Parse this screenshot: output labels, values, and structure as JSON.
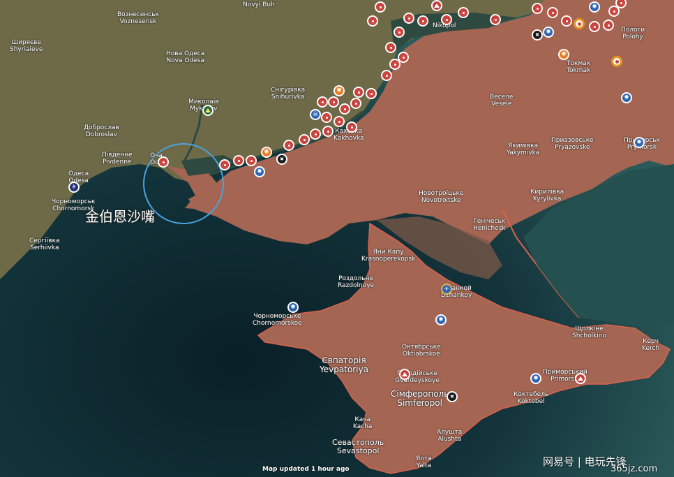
{
  "map": {
    "colors": {
      "sea_deep": "#0e2a33",
      "sea_shallow": "#2b5a5a",
      "ukraine_land": "#6e6a48",
      "occupied_land": "#a46552",
      "occupied_border": "#d9634f",
      "river": "#2e4a40",
      "circle": "#4aa3e0"
    },
    "highlight_label": "金伯恩沙嘴",
    "status_text": "Map updated 1 hour ago",
    "watermark": {
      "line1": "网易号 | 电玩先锋",
      "line2": "365jz.com"
    },
    "places": [
      {
        "key": "voznesensk",
        "name": "Вознесенськ",
        "latin": "Voznesensk"
      },
      {
        "key": "novyi_buh",
        "name": "Novyi Buh",
        "latin": ""
      },
      {
        "key": "shyriaieve",
        "name": "Ширяєве",
        "latin": "Shyriaieve"
      },
      {
        "key": "nova_odesa",
        "name": "Нова Одеса",
        "latin": "Nova Odesa"
      },
      {
        "key": "mykolaiv",
        "name": "Миколаїв",
        "latin": "Mykolaiv"
      },
      {
        "key": "snihurivka",
        "name": "Снігурівка",
        "latin": "Snihurivka"
      },
      {
        "key": "dobroslav",
        "name": "Доброслав",
        "latin": "Dobroslav"
      },
      {
        "key": "pivdenne",
        "name": "Південне",
        "latin": "Pivdenne"
      },
      {
        "key": "ochakiv",
        "name": "Оча",
        "latin": "Och"
      },
      {
        "key": "odesa",
        "name": "Одеса",
        "latin": "Odesa"
      },
      {
        "key": "chornomorsk",
        "name": "Чорноморськ",
        "latin": "Chornomorsk"
      },
      {
        "key": "serhiivka",
        "name": "Сергіївка",
        "latin": "Serhiivka"
      },
      {
        "key": "nikopol",
        "name": "Nikopol",
        "latin": ""
      },
      {
        "key": "polohy",
        "name": "Пологи",
        "latin": "Polohy"
      },
      {
        "key": "tokmak",
        "name": "Токмак",
        "latin": "Tokmak"
      },
      {
        "key": "vesele",
        "name": "Веселе",
        "latin": "Vesele"
      },
      {
        "key": "kakhovka",
        "name": "Каховка",
        "latin": "Kakhovka"
      },
      {
        "key": "pryazovske",
        "name": "Приазовське",
        "latin": "Pryazovske"
      },
      {
        "key": "yakymivka",
        "name": "Якимівка",
        "latin": "Yakymivka"
      },
      {
        "key": "prymorsk",
        "name": "Приморськ",
        "latin": "Prymorsk"
      },
      {
        "key": "novotroitske",
        "name": "Новотроїцьке",
        "latin": "Novotroitske"
      },
      {
        "key": "kyrylivka",
        "name": "Кирилівка",
        "latin": "Kyrylivka"
      },
      {
        "key": "henichesk",
        "name": "Генічеськ",
        "latin": "Henichesk"
      },
      {
        "key": "krasnoperekopsk",
        "name": "Яни Капу",
        "latin": "Krasnoperekopsk"
      },
      {
        "key": "rozdolne",
        "name": "Роздольне",
        "latin": "Razdolnoye"
      },
      {
        "key": "dzhankoi",
        "name": "Джанкой",
        "latin": "Dzhankoy"
      },
      {
        "key": "chornomorske",
        "name": "Чорноморське",
        "latin": "Chornomorskoe"
      },
      {
        "key": "shcholkine",
        "name": "Щолкіне",
        "latin": "Shcholkino"
      },
      {
        "key": "kerch",
        "name": "Керч",
        "latin": "Kerch"
      },
      {
        "key": "yevpatoriia",
        "name": "Євпаторія",
        "latin": "Yevpatoriya"
      },
      {
        "key": "oktiabrske",
        "name": "Октябрське",
        "latin": "Oktiabrskoe"
      },
      {
        "key": "hvardiiske",
        "name": "Гвардійське",
        "latin": "Gvardeyskoye"
      },
      {
        "key": "prymorskyi",
        "name": "Приморський",
        "latin": "Primorski"
      },
      {
        "key": "simferopol",
        "name": "Сімферополь",
        "latin": "Simferopol"
      },
      {
        "key": "koktebel",
        "name": "Коктебель",
        "latin": "Koktebel"
      },
      {
        "key": "kacha",
        "name": "Кача",
        "latin": "Kacha"
      },
      {
        "key": "alushta",
        "name": "Алушта",
        "latin": "Alushta"
      },
      {
        "key": "sevastopol",
        "name": "Севастополь",
        "latin": "Sevastopol"
      },
      {
        "key": "yalta",
        "name": "Ялта",
        "latin": "Yalta"
      }
    ]
  }
}
